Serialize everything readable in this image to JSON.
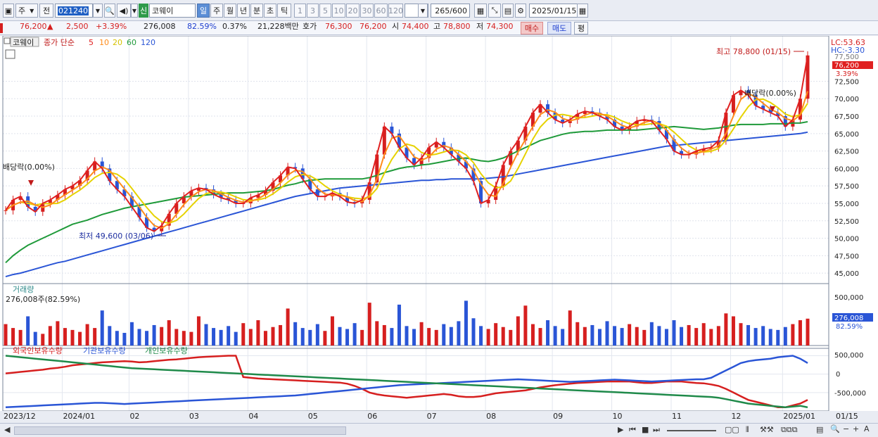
{
  "toolbar": {
    "period_type": "주",
    "prev_label": "전",
    "stock_code": "021240",
    "new_badge": "신",
    "stock_name": "코웨이",
    "period_tabs": [
      "일",
      "주",
      "월",
      "년",
      "분",
      "초",
      "틱"
    ],
    "active_period": "일",
    "interval_buttons": [
      "1",
      "3",
      "5",
      "10",
      "20",
      "30",
      "60",
      "120"
    ],
    "count_value": "265",
    "count_max": "/600",
    "date_value": "2025/01/15"
  },
  "quote": {
    "price": "76,200",
    "change_arrow": "▲",
    "change": "2,500",
    "change_pct": "+3.39%",
    "volume": "276,008",
    "volume_ratio": "82.59%",
    "turnover": "0.37%",
    "amount": "21,228백만",
    "ask_label": "호가",
    "ask": "76,300",
    "bid": "76,200",
    "open_label": "시",
    "open": "74,400",
    "high_label": "고",
    "high": "78,800",
    "low_label": "저",
    "low": "74,300",
    "buy_label": "매수",
    "sell_label": "매도",
    "eval_label": "평"
  },
  "legend": {
    "name": "코웨이",
    "ma_prefix": "종가 단순",
    "ma_periods": [
      "5",
      "10",
      "20",
      "60",
      "120"
    ],
    "ma_colors": [
      "#e02020",
      "#ff8c1a",
      "#e6d200",
      "#1f9a3a",
      "#2a55d6"
    ]
  },
  "axis": {
    "price_ticks": [
      "72,500",
      "70,000",
      "67,500",
      "65,000",
      "62,500",
      "60,000",
      "57,500",
      "55,000",
      "52,500",
      "50,000",
      "47,500",
      "45,000"
    ],
    "price_ticks_values": [
      72500,
      70000,
      67500,
      65000,
      62500,
      60000,
      57500,
      55000,
      52500,
      50000,
      47500,
      45000
    ],
    "lc": "LC:53.63",
    "hc": "HC:-3.30",
    "top_tick": "77,500",
    "last_price_tag": "76,200",
    "last_pct_tag": "3.39%",
    "volume_ticks": [
      "500,000"
    ],
    "volume_tag": "276,008",
    "volume_pct_tag": "82.59%",
    "holding_ticks": [
      "500,000",
      "0",
      "-500,000"
    ],
    "dates": [
      "2023/12",
      "2024/01",
      "02",
      "03",
      "04",
      "05",
      "06",
      "07",
      "08",
      "09",
      "10",
      "11",
      "12",
      "2025/01"
    ],
    "date_right": "01/15"
  },
  "annotations": {
    "high": "최고 78,800 (01/15)",
    "low": "최저 49,600 (03/06)",
    "dividend_left": "배당락(0.00%)",
    "dividend_right": "배당락(0.00%)"
  },
  "volume_panel": {
    "title": "거래량",
    "info": "276,008주(82.59%)"
  },
  "holding_panel": {
    "series": [
      "외국인보유수량",
      "기관보유수량",
      "개인보유수량"
    ],
    "colors": [
      "#d61f1f",
      "#2a55d6",
      "#1f8a4a"
    ]
  },
  "chart_data": {
    "type": "line",
    "title": "코웨이",
    "price": {
      "ylim": [
        43500,
        79000
      ],
      "close": [
        54000,
        55500,
        56000,
        54500,
        53800,
        55000,
        55500,
        56200,
        57000,
        57500,
        58300,
        59700,
        61000,
        60000,
        58200,
        57000,
        56000,
        54500,
        53000,
        51500,
        51000,
        51800,
        53500,
        55000,
        56000,
        56800,
        57200,
        57000,
        56300,
        55800,
        55500,
        55000,
        55000,
        55800,
        56200,
        56800,
        58000,
        59000,
        60200,
        60000,
        58500,
        57000,
        56000,
        56000,
        56500,
        56000,
        55200,
        55000,
        55500,
        58000,
        62000,
        66000,
        65000,
        63000,
        61500,
        60500,
        61500,
        63000,
        63800,
        63000,
        62000,
        61000,
        60000,
        58200,
        55000,
        55500,
        57500,
        60500,
        62500,
        64000,
        66000,
        68000,
        69200,
        68000,
        67000,
        66500,
        67000,
        67800,
        68200,
        68000,
        67500,
        67000,
        66000,
        65500,
        66000,
        66800,
        67000,
        66800,
        65500,
        64200,
        62500,
        62000,
        62000,
        62500,
        62800,
        63000,
        64000,
        68000,
        70500,
        71200,
        70500,
        69000,
        68500,
        68000,
        67500,
        66000,
        67000,
        70000,
        76200
      ],
      "ma60": [
        46500,
        47500,
        48300,
        49000,
        49500,
        50000,
        50500,
        51000,
        51500,
        52000,
        52300,
        52600,
        53000,
        53400,
        53700,
        54000,
        54300,
        54500,
        54700,
        54900,
        55100,
        55300,
        55500,
        55700,
        55900,
        56000,
        56100,
        56200,
        56300,
        56400,
        56500,
        56500,
        56500,
        56600,
        56700,
        56800,
        57000,
        57300,
        57600,
        57800,
        58100,
        58300,
        58400,
        58500,
        58500,
        58500,
        58500,
        58500,
        58500,
        58700,
        59000,
        59400,
        59700,
        60000,
        60200,
        60300,
        60500,
        60600,
        60800,
        61000,
        61200,
        61400,
        61500,
        61300,
        61100,
        61000,
        61200,
        61500,
        62000,
        62500,
        63000,
        63500,
        64000,
        64300,
        64600,
        64900,
        65100,
        65200,
        65300,
        65300,
        65400,
        65500,
        65500,
        65500,
        65500,
        65500,
        65600,
        65700,
        65800,
        65900,
        66000,
        65900,
        65800,
        65700,
        65600,
        65700,
        65800,
        66000,
        66200,
        66300,
        66300,
        66300,
        66300,
        66400,
        66400,
        66400,
        66500,
        66500,
        66700
      ],
      "ma120": [
        44500,
        44800,
        45000,
        45300,
        45600,
        45900,
        46200,
        46500,
        46700,
        47000,
        47300,
        47600,
        47900,
        48200,
        48500,
        48800,
        49100,
        49400,
        49700,
        50000,
        50300,
        50600,
        50900,
        51200,
        51500,
        51800,
        52100,
        52400,
        52700,
        53000,
        53300,
        53600,
        53900,
        54200,
        54500,
        54800,
        55100,
        55400,
        55700,
        56000,
        56200,
        56400,
        56600,
        56800,
        57000,
        57200,
        57300,
        57400,
        57500,
        57600,
        57700,
        57800,
        57900,
        58000,
        58100,
        58200,
        58300,
        58300,
        58400,
        58400,
        58500,
        58500,
        58500,
        58500,
        58500,
        58600,
        58700,
        58800,
        59000,
        59200,
        59400,
        59600,
        59800,
        60000,
        60200,
        60400,
        60600,
        60800,
        61000,
        61200,
        61400,
        61600,
        61800,
        62000,
        62200,
        62400,
        62600,
        62800,
        63000,
        63200,
        63300,
        63400,
        63500,
        63600,
        63700,
        63800,
        63900,
        64000,
        64100,
        64200,
        64300,
        64400,
        64500,
        64600,
        64700,
        64800,
        64900,
        65000,
        65200
      ]
    },
    "volume": {
      "ylim": [
        0,
        600000
      ],
      "values": [
        220000,
        180000,
        160000,
        300000,
        140000,
        120000,
        200000,
        250000,
        180000,
        160000,
        140000,
        220000,
        180000,
        360000,
        200000,
        150000,
        130000,
        240000,
        170000,
        150000,
        210000,
        190000,
        260000,
        170000,
        150000,
        140000,
        300000,
        220000,
        180000,
        160000,
        200000,
        140000,
        230000,
        170000,
        260000,
        150000,
        190000,
        210000,
        380000,
        240000,
        180000,
        160000,
        220000,
        150000,
        300000,
        190000,
        170000,
        230000,
        160000,
        440000,
        250000,
        210000,
        180000,
        420000,
        200000,
        170000,
        240000,
        180000,
        160000,
        220000,
        190000,
        250000,
        460000,
        280000,
        200000,
        170000,
        230000,
        190000,
        160000,
        300000,
        410000,
        220000,
        180000,
        260000,
        200000,
        170000,
        360000,
        240000,
        190000,
        210000,
        170000,
        250000,
        200000,
        180000,
        220000,
        190000,
        160000,
        240000,
        200000,
        170000,
        260000,
        190000,
        210000,
        180000,
        230000,
        170000,
        200000,
        330000,
        300000,
        230000,
        210000,
        180000,
        200000,
        170000,
        160000,
        190000,
        220000,
        260000,
        276008
      ]
    },
    "holdings": {
      "ylim": [
        -1000000,
        700000
      ],
      "series": [
        {
          "name": "외국인보유수량",
          "values": [
            20000,
            40000,
            60000,
            80000,
            100000,
            120000,
            150000,
            170000,
            200000,
            240000,
            260000,
            280000,
            300000,
            320000,
            330000,
            340000,
            350000,
            340000,
            320000,
            330000,
            350000,
            370000,
            390000,
            400000,
            420000,
            440000,
            460000,
            470000,
            480000,
            490000,
            500000,
            500000,
            -80000,
            -100000,
            -120000,
            -130000,
            -140000,
            -150000,
            -160000,
            -170000,
            -180000,
            -190000,
            -200000,
            -210000,
            -220000,
            -230000,
            -260000,
            -320000,
            -400000,
            -500000,
            -550000,
            -580000,
            -600000,
            -620000,
            -640000,
            -620000,
            -600000,
            -580000,
            -560000,
            -540000,
            -560000,
            -600000,
            -620000,
            -620000,
            -600000,
            -560000,
            -520000,
            -500000,
            -480000,
            -460000,
            -440000,
            -400000,
            -360000,
            -330000,
            -300000,
            -280000,
            -260000,
            -240000,
            -230000,
            -220000,
            -210000,
            -200000,
            -200000,
            -200000,
            -200000,
            -220000,
            -240000,
            -240000,
            -220000,
            -200000,
            -200000,
            -200000,
            -220000,
            -240000,
            -250000,
            -280000,
            -320000,
            -400000,
            -500000,
            -600000,
            -700000,
            -750000,
            -800000,
            -850000,
            -900000,
            -900000,
            -850000,
            -800000,
            -700000
          ]
        },
        {
          "name": "기관보유수량",
          "values": [
            -900000,
            -890000,
            -880000,
            -870000,
            -860000,
            -850000,
            -840000,
            -830000,
            -820000,
            -810000,
            -800000,
            -790000,
            -780000,
            -780000,
            -790000,
            -800000,
            -810000,
            -800000,
            -790000,
            -780000,
            -770000,
            -760000,
            -750000,
            -740000,
            -730000,
            -720000,
            -710000,
            -700000,
            -690000,
            -680000,
            -670000,
            -660000,
            -650000,
            -640000,
            -630000,
            -620000,
            -610000,
            -600000,
            -590000,
            -580000,
            -560000,
            -540000,
            -520000,
            -500000,
            -480000,
            -460000,
            -440000,
            -420000,
            -400000,
            -380000,
            -360000,
            -340000,
            -320000,
            -300000,
            -290000,
            -280000,
            -270000,
            -260000,
            -250000,
            -240000,
            -230000,
            -220000,
            -210000,
            -200000,
            -190000,
            -180000,
            -170000,
            -160000,
            -150000,
            -140000,
            -150000,
            -160000,
            -170000,
            -180000,
            -190000,
            -200000,
            -210000,
            -200000,
            -190000,
            -180000,
            -170000,
            -160000,
            -150000,
            -160000,
            -170000,
            -180000,
            -190000,
            -200000,
            -190000,
            -180000,
            -170000,
            -160000,
            -150000,
            -140000,
            -140000,
            -100000,
            0,
            100000,
            200000,
            300000,
            350000,
            380000,
            400000,
            420000,
            460000,
            480000,
            500000,
            420000,
            300000
          ]
        },
        {
          "name": "개인보유수량",
          "values": [
            500000,
            480000,
            460000,
            440000,
            420000,
            400000,
            380000,
            360000,
            340000,
            320000,
            300000,
            280000,
            260000,
            240000,
            220000,
            200000,
            180000,
            160000,
            150000,
            140000,
            130000,
            120000,
            110000,
            100000,
            90000,
            80000,
            70000,
            60000,
            50000,
            40000,
            30000,
            20000,
            10000,
            0,
            -10000,
            -20000,
            -30000,
            -40000,
            -50000,
            -60000,
            -70000,
            -80000,
            -90000,
            -100000,
            -110000,
            -120000,
            -130000,
            -140000,
            -150000,
            -160000,
            -170000,
            -180000,
            -190000,
            -200000,
            -210000,
            -220000,
            -230000,
            -240000,
            -250000,
            -260000,
            -270000,
            -280000,
            -290000,
            -300000,
            -310000,
            -320000,
            -330000,
            -340000,
            -350000,
            -360000,
            -370000,
            -380000,
            -390000,
            -400000,
            -410000,
            -420000,
            -430000,
            -440000,
            -450000,
            -460000,
            -470000,
            -480000,
            -490000,
            -500000,
            -510000,
            -520000,
            -530000,
            -540000,
            -550000,
            -560000,
            -570000,
            -580000,
            -590000,
            -600000,
            -610000,
            -620000,
            -640000,
            -680000,
            -720000,
            -760000,
            -800000,
            -820000,
            -840000,
            -860000,
            -880000,
            -900000,
            -880000,
            -860000,
            -900000
          ]
        }
      ]
    }
  }
}
